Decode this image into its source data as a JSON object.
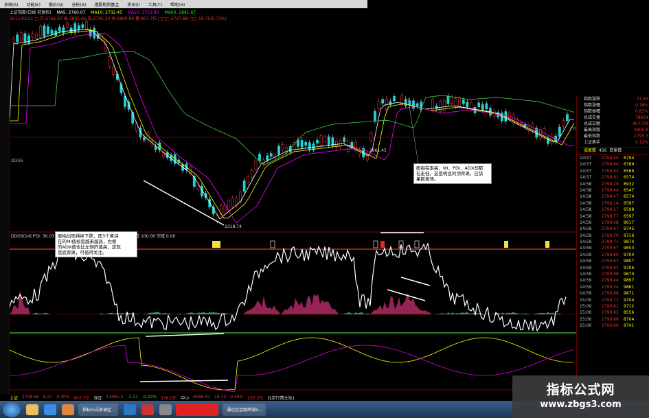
{
  "menu": [
    "系统(S)",
    "功能(E)",
    "报价(Q)",
    "分析(A)",
    "港股期货基金",
    "资讯(I)",
    "工具(T)",
    "帮助(H)"
  ],
  "info": {
    "title": "上证指数(日线 前复权)",
    "ma5": "MA5: 2760.07",
    "ma10": "MA10: 2732.45",
    "ma20": "MA20: 2753.80",
    "ma60": "MA60: 2841.67",
    "row2": "2011/02/21 □ 开:2766.67 高:2805.65 低:2795.30 收:2800.96 量:907.7亿 □□□ 2797.88 □□ 19.75(0.71%)"
  },
  "price_labels": {
    "peak": "2661.45",
    "low": "2318.74"
  },
  "axis_labels": {
    "left": "DDGS",
    "right_top": "2750"
  },
  "indicator": {
    "header": "DDGS(14) PDI: 30.03  MDI: 21.70  ADX: 35.79  ADXR: 49.54  完成 100.00  完成 0.00"
  },
  "notes": {
    "left": "股指出现持续下跌，而3个黄块\n在的MI值却是越来越高，右侧\n的ADX值也比左侧的值高，这就\n是底背离，可值得关注。",
    "right": "股指在走高，MI、PDI、ADX却都\n在走低，这是明显的顶背离，应该\n果断离场。"
  },
  "panel": {
    "stats": [
      {
        "label": "指数涨跌",
        "value": "21.83"
      },
      {
        "label": "指数涨幅",
        "value": "0.78%"
      },
      {
        "label": "指数振幅",
        "value": "0.81%"
      },
      {
        "label": "总成交量",
        "value": "78654"
      },
      {
        "label": "总成交额",
        "value": "907779"
      },
      {
        "label": "最高指数",
        "value": "2805.6"
      },
      {
        "label": "最低指数",
        "value": "2795.3"
      },
      {
        "label": "上证换手",
        "value": "0.12%"
      }
    ],
    "tabs": [
      "涨家数",
      "456",
      "跌家数"
    ],
    "ticks": [
      {
        "t": "14:57",
        "p": "2798.50",
        "v": "6794"
      },
      {
        "t": "14:57",
        "p": "2798.66",
        "v": "6789"
      },
      {
        "t": "14:57",
        "p": "2798.93",
        "v": "6589"
      },
      {
        "t": "14:57",
        "p": "2798.91",
        "v": "6574"
      },
      {
        "t": "14:58",
        "p": "2798.29",
        "v": "8932"
      },
      {
        "t": "14:58",
        "p": "2798.44",
        "v": "6547"
      },
      {
        "t": "14:58",
        "p": "2798.47",
        "v": "6574"
      },
      {
        "t": "14:58",
        "p": "2798.14",
        "v": "6597"
      },
      {
        "t": "14:58",
        "p": "2798.27",
        "v": "6598"
      },
      {
        "t": "14:58",
        "p": "2798.77",
        "v": "6597"
      },
      {
        "t": "14:59",
        "p": "2799.08",
        "v": "9017"
      },
      {
        "t": "14:59",
        "p": "2799.67",
        "v": "9745"
      },
      {
        "t": "14:59",
        "p": "2799.70",
        "v": "9716"
      },
      {
        "t": "14:59",
        "p": "2799.71",
        "v": "9874"
      },
      {
        "t": "14:59",
        "p": "2799.67",
        "v": "9653"
      },
      {
        "t": "14:59",
        "p": "2799.80",
        "v": "9704"
      },
      {
        "t": "14:59",
        "p": "2799.63",
        "v": "9807"
      },
      {
        "t": "14:59",
        "p": "2799.91",
        "v": "9706"
      },
      {
        "t": "14:59",
        "p": "2799.99",
        "v": "9670"
      },
      {
        "t": "14:59",
        "p": "2799.44",
        "v": "9897"
      },
      {
        "t": "14:59",
        "p": "2799.54",
        "v": "9861"
      },
      {
        "t": "14:59",
        "p": "2799.88",
        "v": "9871"
      },
      {
        "t": "15:00",
        "p": "2799.71",
        "v": "9704"
      },
      {
        "t": "15:00",
        "p": "2799.81",
        "v": "9712"
      },
      {
        "t": "15:00",
        "p": "2799.82",
        "v": "8556"
      },
      {
        "t": "15:00",
        "p": "2799.88",
        "v": "8704"
      },
      {
        "t": "15:00",
        "p": "2799.90",
        "v": "9741"
      }
    ]
  },
  "status": {
    "name": "上证",
    "items": [
      "2798.96",
      "8.37",
      "0.30%",
      "907.7亿",
      "深证",
      "11991.5",
      "-3.17",
      "-0.03%",
      "576.0亿",
      "中小",
      "6186.91",
      "16.13",
      "0.26%",
      "207.2亿",
      "北京行情主站1"
    ]
  },
  "taskbar": {
    "buttons": [
      "指标公式收录区 -",
      "通达信金融终端V..."
    ]
  },
  "watermark": {
    "line1": "指标公式网",
    "line2": "www.zbgs3.com"
  },
  "colors": {
    "bull": "#e23a3a",
    "bear": "#22d2d2",
    "teal_fill": "#2aa3a3",
    "magenta_fill": "#a3285e",
    "yellow_mark": "#f0e040"
  }
}
